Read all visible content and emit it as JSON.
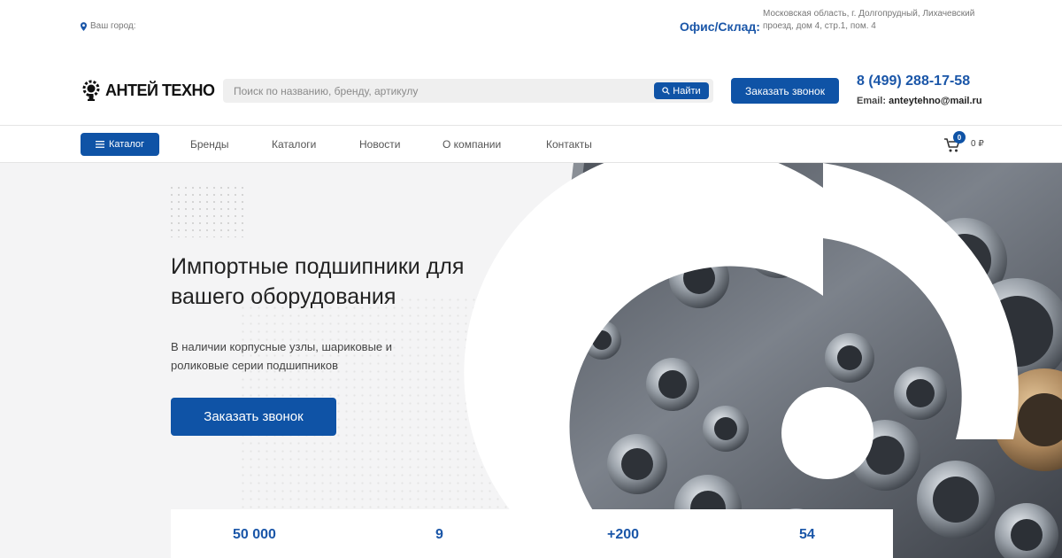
{
  "topbar": {
    "city_label": "Ваш город:",
    "office_label": "Офис/Склад:",
    "office_address": "Московская область, г. Долгопрудный, Лихачевский проезд, дом 4, стр.1, пом. 4"
  },
  "header": {
    "logo_text": "АНТЕЙ ТЕХНО",
    "search_placeholder": "Поиск по названию, бренду, артикулу",
    "search_button": "Найти",
    "call_button": "Заказать звонок",
    "phone": "8 (499) 288-17-58",
    "email_label": "Email:",
    "email": "anteytehno@mail.ru"
  },
  "nav": {
    "catalog_button": "Каталог",
    "items": [
      "Бренды",
      "Каталоги",
      "Новости",
      "О компании",
      "Контакты"
    ],
    "cart_count": "0",
    "cart_sum": "0 ₽"
  },
  "hero": {
    "title": "Импортные подшипники для вашего оборудования",
    "subtitle": "В наличии корпусные узлы, шариковые и роликовые серии подшипников",
    "button": "Заказать звонок"
  },
  "stats": [
    "50 000",
    "9",
    "+200",
    "54"
  ],
  "colors": {
    "brand_blue": "#0f53a6",
    "link_blue": "#1a56a8"
  }
}
